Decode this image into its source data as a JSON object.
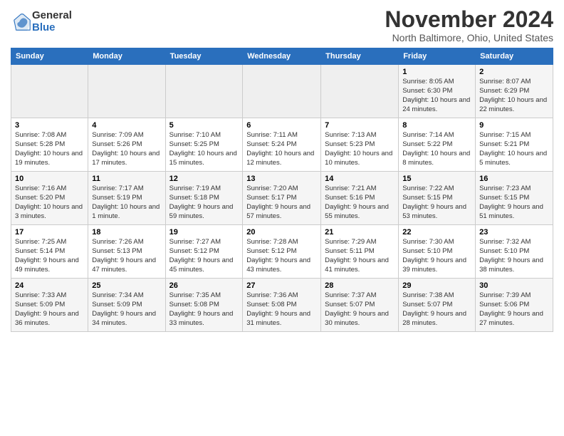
{
  "logo": {
    "general": "General",
    "blue": "Blue"
  },
  "title": "November 2024",
  "location": "North Baltimore, Ohio, United States",
  "days_of_week": [
    "Sunday",
    "Monday",
    "Tuesday",
    "Wednesday",
    "Thursday",
    "Friday",
    "Saturday"
  ],
  "weeks": [
    [
      {
        "day": "",
        "info": ""
      },
      {
        "day": "",
        "info": ""
      },
      {
        "day": "",
        "info": ""
      },
      {
        "day": "",
        "info": ""
      },
      {
        "day": "",
        "info": ""
      },
      {
        "day": "1",
        "info": "Sunrise: 8:05 AM\nSunset: 6:30 PM\nDaylight: 10 hours and 24 minutes."
      },
      {
        "day": "2",
        "info": "Sunrise: 8:07 AM\nSunset: 6:29 PM\nDaylight: 10 hours and 22 minutes."
      }
    ],
    [
      {
        "day": "3",
        "info": "Sunrise: 7:08 AM\nSunset: 5:28 PM\nDaylight: 10 hours and 19 minutes."
      },
      {
        "day": "4",
        "info": "Sunrise: 7:09 AM\nSunset: 5:26 PM\nDaylight: 10 hours and 17 minutes."
      },
      {
        "day": "5",
        "info": "Sunrise: 7:10 AM\nSunset: 5:25 PM\nDaylight: 10 hours and 15 minutes."
      },
      {
        "day": "6",
        "info": "Sunrise: 7:11 AM\nSunset: 5:24 PM\nDaylight: 10 hours and 12 minutes."
      },
      {
        "day": "7",
        "info": "Sunrise: 7:13 AM\nSunset: 5:23 PM\nDaylight: 10 hours and 10 minutes."
      },
      {
        "day": "8",
        "info": "Sunrise: 7:14 AM\nSunset: 5:22 PM\nDaylight: 10 hours and 8 minutes."
      },
      {
        "day": "9",
        "info": "Sunrise: 7:15 AM\nSunset: 5:21 PM\nDaylight: 10 hours and 5 minutes."
      }
    ],
    [
      {
        "day": "10",
        "info": "Sunrise: 7:16 AM\nSunset: 5:20 PM\nDaylight: 10 hours and 3 minutes."
      },
      {
        "day": "11",
        "info": "Sunrise: 7:17 AM\nSunset: 5:19 PM\nDaylight: 10 hours and 1 minute."
      },
      {
        "day": "12",
        "info": "Sunrise: 7:19 AM\nSunset: 5:18 PM\nDaylight: 9 hours and 59 minutes."
      },
      {
        "day": "13",
        "info": "Sunrise: 7:20 AM\nSunset: 5:17 PM\nDaylight: 9 hours and 57 minutes."
      },
      {
        "day": "14",
        "info": "Sunrise: 7:21 AM\nSunset: 5:16 PM\nDaylight: 9 hours and 55 minutes."
      },
      {
        "day": "15",
        "info": "Sunrise: 7:22 AM\nSunset: 5:15 PM\nDaylight: 9 hours and 53 minutes."
      },
      {
        "day": "16",
        "info": "Sunrise: 7:23 AM\nSunset: 5:15 PM\nDaylight: 9 hours and 51 minutes."
      }
    ],
    [
      {
        "day": "17",
        "info": "Sunrise: 7:25 AM\nSunset: 5:14 PM\nDaylight: 9 hours and 49 minutes."
      },
      {
        "day": "18",
        "info": "Sunrise: 7:26 AM\nSunset: 5:13 PM\nDaylight: 9 hours and 47 minutes."
      },
      {
        "day": "19",
        "info": "Sunrise: 7:27 AM\nSunset: 5:12 PM\nDaylight: 9 hours and 45 minutes."
      },
      {
        "day": "20",
        "info": "Sunrise: 7:28 AM\nSunset: 5:12 PM\nDaylight: 9 hours and 43 minutes."
      },
      {
        "day": "21",
        "info": "Sunrise: 7:29 AM\nSunset: 5:11 PM\nDaylight: 9 hours and 41 minutes."
      },
      {
        "day": "22",
        "info": "Sunrise: 7:30 AM\nSunset: 5:10 PM\nDaylight: 9 hours and 39 minutes."
      },
      {
        "day": "23",
        "info": "Sunrise: 7:32 AM\nSunset: 5:10 PM\nDaylight: 9 hours and 38 minutes."
      }
    ],
    [
      {
        "day": "24",
        "info": "Sunrise: 7:33 AM\nSunset: 5:09 PM\nDaylight: 9 hours and 36 minutes."
      },
      {
        "day": "25",
        "info": "Sunrise: 7:34 AM\nSunset: 5:09 PM\nDaylight: 9 hours and 34 minutes."
      },
      {
        "day": "26",
        "info": "Sunrise: 7:35 AM\nSunset: 5:08 PM\nDaylight: 9 hours and 33 minutes."
      },
      {
        "day": "27",
        "info": "Sunrise: 7:36 AM\nSunset: 5:08 PM\nDaylight: 9 hours and 31 minutes."
      },
      {
        "day": "28",
        "info": "Sunrise: 7:37 AM\nSunset: 5:07 PM\nDaylight: 9 hours and 30 minutes."
      },
      {
        "day": "29",
        "info": "Sunrise: 7:38 AM\nSunset: 5:07 PM\nDaylight: 9 hours and 28 minutes."
      },
      {
        "day": "30",
        "info": "Sunrise: 7:39 AM\nSunset: 5:06 PM\nDaylight: 9 hours and 27 minutes."
      }
    ]
  ]
}
